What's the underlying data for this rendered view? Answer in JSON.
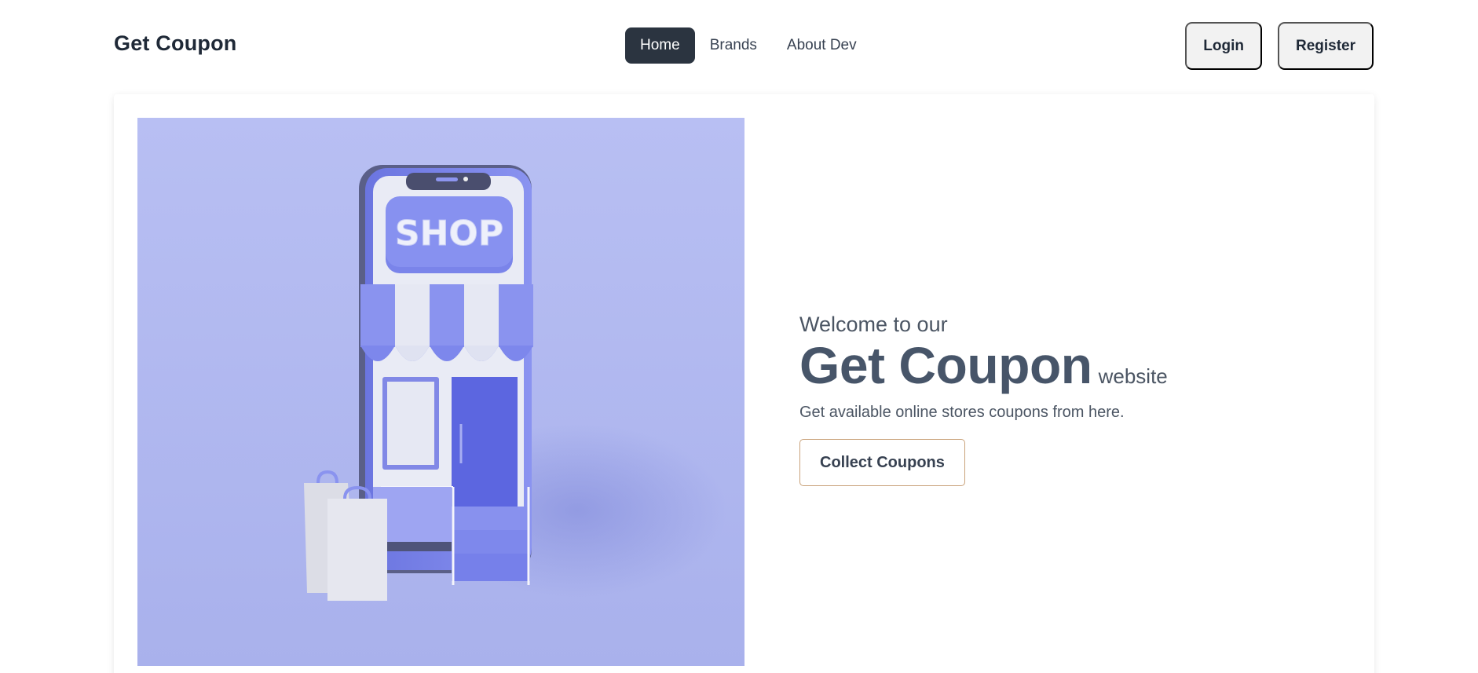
{
  "brand": "Get Coupon",
  "nav": {
    "links": [
      {
        "label": "Home",
        "active": true
      },
      {
        "label": "Brands",
        "active": false
      },
      {
        "label": "About Dev",
        "active": false
      }
    ]
  },
  "auth": {
    "login_label": "Login",
    "register_label": "Register"
  },
  "hero": {
    "image_sign_text": "SHOP",
    "welcome": "Welcome to our",
    "title": "Get Coupon",
    "title_suffix": "website",
    "subtitle": "Get available online stores coupons from here.",
    "cta_label": "Collect Coupons"
  },
  "colors": {
    "nav_active_bg": "#2b3440",
    "image_bg": "#b9c0f2",
    "accent_blue": "#7c86ea",
    "cta_border": "#c9a27a"
  }
}
